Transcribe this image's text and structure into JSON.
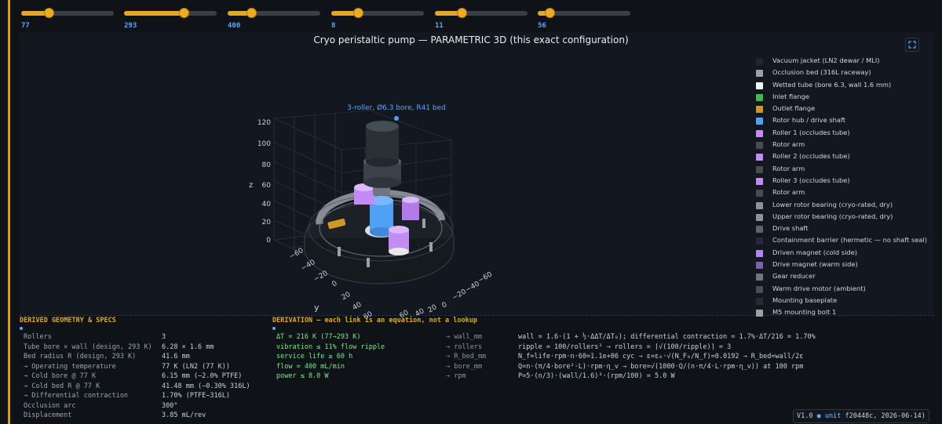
{
  "sliders": [
    {
      "value": "77",
      "fraction": 0.3
    },
    {
      "value": "293",
      "fraction": 0.64
    },
    {
      "value": "400",
      "fraction": 0.25
    },
    {
      "value": "8",
      "fraction": 0.29
    },
    {
      "value": "11",
      "fraction": 0.29
    },
    {
      "value": "56",
      "fraction": 0.13
    }
  ],
  "plot": {
    "title": "Cryo peristaltic pump — PARAMETRIC 3D (this exact configuration)",
    "annotation": "3-roller, Ø6.3 bore, R41 bed",
    "axes": {
      "z_label": "z",
      "y_label": "y",
      "x_label": "x",
      "z_ticks": [
        "120",
        "100",
        "80",
        "60",
        "40",
        "20",
        "0"
      ],
      "y_ticks": [
        "−60",
        "−40",
        "−20",
        "0",
        "20",
        "40",
        "60"
      ],
      "x_ticks": [
        "−60",
        "−40",
        "−20",
        "0",
        "20",
        "40",
        "60"
      ]
    }
  },
  "legend": [
    {
      "label": "Vacuum jacket (LN2 dewar / MLI)",
      "color": "#1f2630"
    },
    {
      "label": "Occlusion bed (316L raceway)",
      "color": "#9aa0a6"
    },
    {
      "label": "Wetted tube (bore 6.3, wall 1.6 mm)",
      "color": "#f4f4f4"
    },
    {
      "label": "Inlet flange",
      "color": "#3fb950"
    },
    {
      "label": "Outlet flange",
      "color": "#d29922"
    },
    {
      "label": "Rotor hub / drive shaft",
      "color": "#4ea1f5"
    },
    {
      "label": "Roller 1 (occludes tube)",
      "color": "#c38cf5"
    },
    {
      "label": "Rotor arm",
      "color": "#444c56"
    },
    {
      "label": "Roller 2 (occludes tube)",
      "color": "#c38cf5"
    },
    {
      "label": "Rotor arm",
      "color": "#444c56"
    },
    {
      "label": "Roller 3 (occludes tube)",
      "color": "#c38cf5"
    },
    {
      "label": "Rotor arm",
      "color": "#444c56"
    },
    {
      "label": "Lower rotor bearing (cryo-rated, dry)",
      "color": "#8b949e"
    },
    {
      "label": "Upper rotor bearing (cryo-rated, dry)",
      "color": "#8b949e"
    },
    {
      "label": "Drive shaft",
      "color": "#5a636e"
    },
    {
      "label": "Containment barrier (hermetic — no shaft seal)",
      "color": "#2d2640"
    },
    {
      "label": "Driven magnet (cold side)",
      "color": "#b085f0"
    },
    {
      "label": "Drive magnet (warm side)",
      "color": "#7d5fb0"
    },
    {
      "label": "Gear reducer",
      "color": "#6e7681"
    },
    {
      "label": "Warm drive motor (ambient)",
      "color": "#484f58"
    },
    {
      "label": "Mounting baseplate",
      "color": "#262c33"
    },
    {
      "label": "M5 mounting bolt 1",
      "color": "#9aa0a6"
    }
  ],
  "specs": {
    "header": "DERIVED GEOMETRY & SPECS",
    "rows": [
      {
        "label": "Rollers",
        "value": "3"
      },
      {
        "label": "Tube bore × wall (design, 293 K)",
        "value": "6.28 × 1.6 mm"
      },
      {
        "label": "Bed radius R (design, 293 K)",
        "value": "41.6 mm"
      },
      {
        "label": "→ Operating temperature",
        "value": "77 K (LN2 (77 K))"
      },
      {
        "label": "→ Cold bore @ 77 K",
        "value": "6.15 mm (−2.0% PTFE)"
      },
      {
        "label": "→ Cold bed R @ 77 K",
        "value": "41.48 mm (−0.30% 316L)"
      },
      {
        "label": "→ Differential contraction",
        "value": "1.70% (PTFE−316L)"
      },
      {
        "label": "Occlusion arc",
        "value": "300°"
      },
      {
        "label": "Displacement",
        "value": "3.85 mL/rev"
      }
    ]
  },
  "derivation": {
    "header": "DERIVATION — each link is an equation, not a lookup",
    "rows": [
      {
        "cond": "ΔT = 216 K (77→293 K)",
        "key": "→ wall_mm",
        "eq": "wall = 1.6·(1 + ½·ΔΔT/ΔT₀); differential contraction = 1.7%·ΔT/216 = 1.70%"
      },
      {
        "cond": "vibration ≤ 11% flow ripple",
        "key": "→ rollers",
        "eq": "ripple = 100/rollers² → rollers = ⌈√(100/ripple)⌉ = 3"
      },
      {
        "cond": "service life ≥ 60 h",
        "key": "→ R_bed_mm",
        "eq": "N_f=life·rpm·n·60=1.1e+06 cyc → ε=ε₀·√(N_F₀/N_f)=0.0192 → R_bed=wall/2ε"
      },
      {
        "cond": "flow = 400 mL/min",
        "key": "→ bore_mm",
        "eq": "Q=n·(π/4·bore²·L)·rpm·η_v → bore=√(1000·Q/(n·π/4·L·rpm·η_v)) at 100 rpm"
      },
      {
        "cond": "power ≤ 8.0 W",
        "key": "→ rpm",
        "eq": "P=5·(n/3)·(wall/1.6)³·(rpm/100) = 5.0 W"
      }
    ]
  },
  "footer": {
    "version": "V1.0",
    "bullet": "●",
    "unit": "unit",
    "build": "f20448c, 2026-06-14)"
  },
  "colors": {
    "accent": "#e3a729",
    "link": "#58a6ff",
    "green": "#7ee787",
    "background": "#0f1318"
  },
  "icons": {
    "expand": "expand-icon"
  }
}
